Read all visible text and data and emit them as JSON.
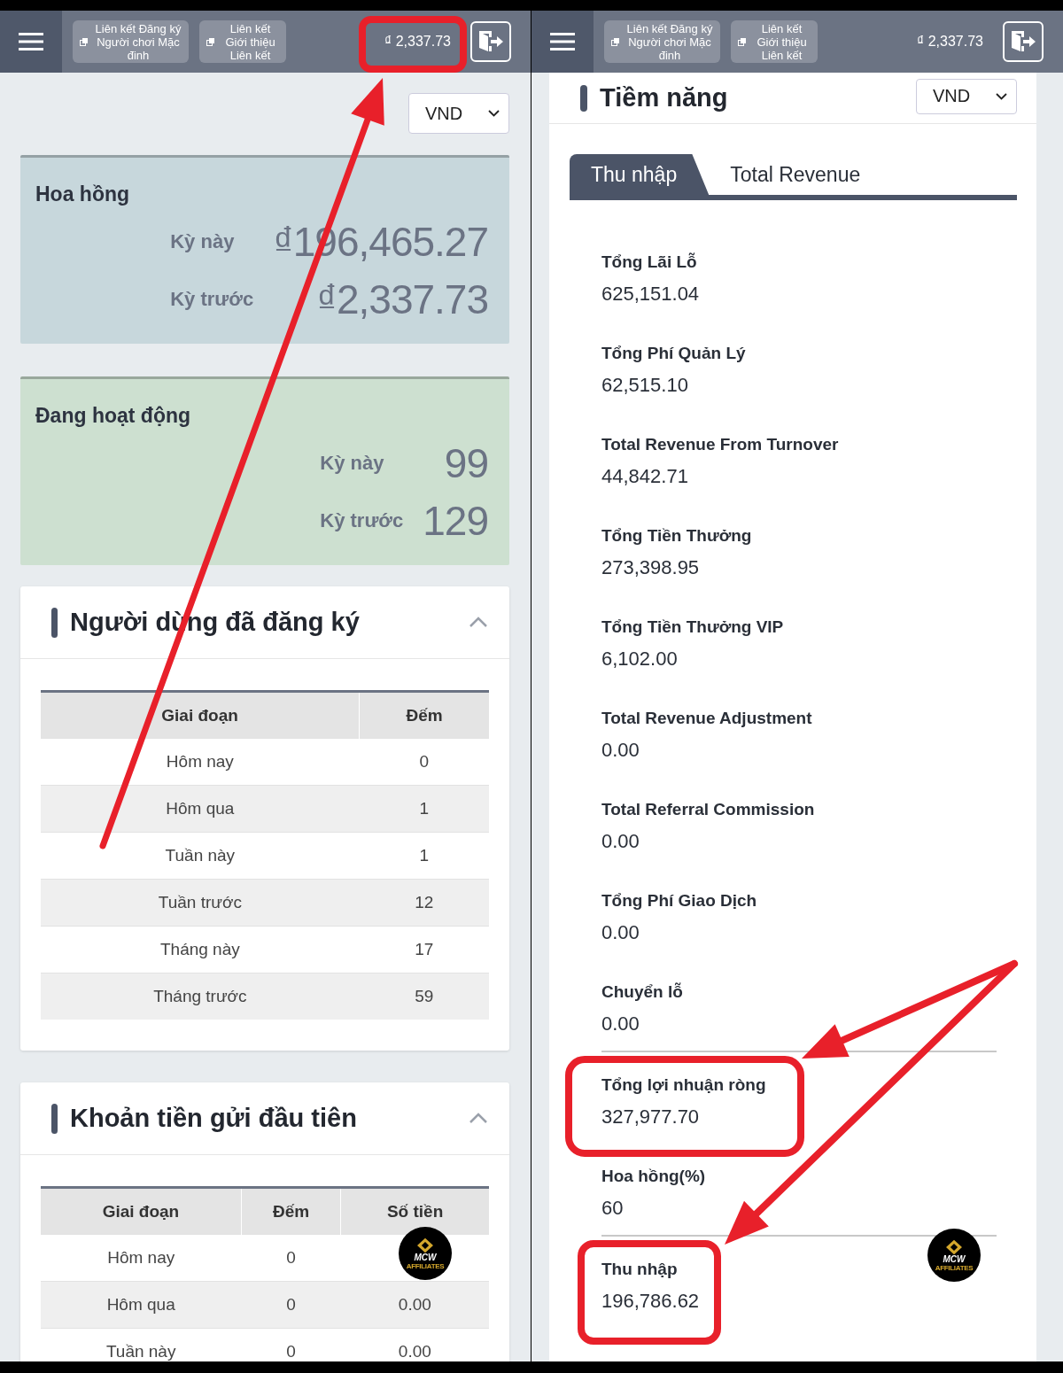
{
  "panels": [
    {
      "header": {
        "links": [
          "Liên kết Đăng ký Người chơi Mặc đinh",
          "Liên kết Giới thiệu Liên kết"
        ],
        "balance": "₫ 2,337.73"
      },
      "currency": "VND",
      "stat_cards": [
        {
          "title": "Hoa hồng",
          "color": "#c7d7dc",
          "rows": [
            {
              "label": "Kỳ này",
              "value": "₫196,465.27"
            },
            {
              "label": "Kỳ trước",
              "value": "₫2,337.73"
            }
          ]
        },
        {
          "title": "Đang hoạt động",
          "color": "#cde0d0",
          "rows": [
            {
              "label": "Kỳ này",
              "value": "99"
            },
            {
              "label": "Kỳ trước",
              "value": "129"
            }
          ]
        }
      ],
      "sections": [
        {
          "title": "Người dùng đã đăng ký",
          "expanded": true,
          "columns": [
            "Giai đoạn",
            "Đếm"
          ],
          "rows": [
            [
              "Hôm nay",
              "0"
            ],
            [
              "Hôm qua",
              "1"
            ],
            [
              "Tuần này",
              "1"
            ],
            [
              "Tuần trước",
              "12"
            ],
            [
              "Tháng này",
              "17"
            ],
            [
              "Tháng trước",
              "59"
            ]
          ]
        },
        {
          "title": "Khoản tiền gửi đầu tiên",
          "expanded": true,
          "columns": [
            "Giai đoạn",
            "Đếm",
            "Số tiền"
          ],
          "rows": [
            [
              "Hôm nay",
              "0"
            ],
            [
              "Hôm qua",
              "0",
              "0.00"
            ],
            [
              "Tuần này",
              "0",
              "0.00"
            ]
          ]
        }
      ],
      "badge": {
        "title": "MCW",
        "subtitle": "AFFILIATES"
      }
    },
    {
      "header": {
        "links": [
          "Liên kết Đăng ký Người chơi Mặc đinh",
          "Liên kết Giới thiệu Liên kết"
        ],
        "balance": "₫ 2,337.73"
      },
      "card": {
        "title": "Tiềm năng",
        "currency": "VND",
        "tabs": [
          {
            "label": "Thu nhập",
            "selected": true
          },
          {
            "label": "Total Revenue",
            "selected": false
          }
        ],
        "items": [
          {
            "label": "Tổng Lãi Lỗ",
            "value": "625,151.04",
            "separated": false
          },
          {
            "label": "Tổng Phí Quản Lý",
            "value": "62,515.10",
            "separated": false
          },
          {
            "label": "Total Revenue From Turnover",
            "value": "44,842.71",
            "separated": false
          },
          {
            "label": "Tổng Tiền Thưởng",
            "value": "273,398.95",
            "separated": false
          },
          {
            "label": "Tổng Tiền Thưởng VIP",
            "value": "6,102.00",
            "separated": false
          },
          {
            "label": "Total Revenue Adjustment",
            "value": "0.00",
            "separated": false
          },
          {
            "label": "Total Referral Commission",
            "value": "0.00",
            "separated": false
          },
          {
            "label": "Tổng Phí Giao Dịch",
            "value": "0.00",
            "separated": false
          },
          {
            "label": "Chuyển lỗ",
            "value": "0.00",
            "separated": false
          },
          {
            "label": "Tổng lợi nhuận ròng",
            "value": "327,977.70",
            "separated": true
          },
          {
            "label": "Hoa hồng(%)",
            "value": "60",
            "separated": false
          },
          {
            "label": "Thu nhập",
            "value": "196,786.62",
            "separated": true
          }
        ]
      },
      "badge": {
        "title": "MCW",
        "subtitle": "AFFILIATES"
      }
    }
  ]
}
